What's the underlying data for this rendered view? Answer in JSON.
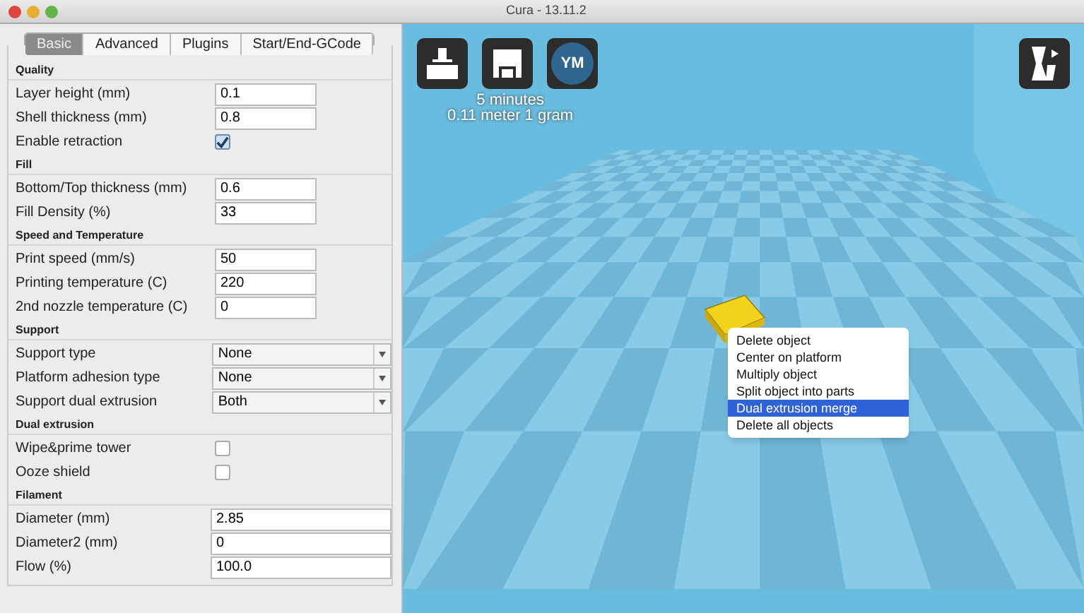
{
  "window": {
    "title": "Cura - 13.11.2"
  },
  "tabs": [
    {
      "label": "Basic",
      "selected": true
    },
    {
      "label": "Advanced",
      "selected": false
    },
    {
      "label": "Plugins",
      "selected": false
    },
    {
      "label": "Start/End-GCode",
      "selected": false
    }
  ],
  "sections": [
    {
      "title": "Quality",
      "items": [
        {
          "kind": "text",
          "label": "Layer height (mm)",
          "value": "0.1"
        },
        {
          "kind": "text",
          "label": "Shell thickness (mm)",
          "value": "0.8"
        },
        {
          "kind": "checkbox",
          "label": "Enable retraction",
          "checked": true
        }
      ]
    },
    {
      "title": "Fill",
      "items": [
        {
          "kind": "text",
          "label": "Bottom/Top thickness (mm)",
          "value": "0.6"
        },
        {
          "kind": "text",
          "label": "Fill Density (%)",
          "value": "33"
        }
      ]
    },
    {
      "title": "Speed and Temperature",
      "items": [
        {
          "kind": "text",
          "label": "Print speed (mm/s)",
          "value": "50"
        },
        {
          "kind": "text",
          "label": "Printing temperature (C)",
          "value": "220"
        },
        {
          "kind": "text",
          "label": "2nd nozzle temperature (C)",
          "value": "0"
        }
      ]
    },
    {
      "title": "Support",
      "items": [
        {
          "kind": "select",
          "label": "Support type",
          "value": "None"
        },
        {
          "kind": "select",
          "label": "Platform adhesion type",
          "value": "None"
        },
        {
          "kind": "select",
          "label": "Support dual extrusion",
          "value": "Both"
        }
      ]
    },
    {
      "title": "Dual extrusion",
      "items": [
        {
          "kind": "checkbox",
          "label": "Wipe&prime tower",
          "checked": false
        },
        {
          "kind": "checkbox",
          "label": "Ooze shield",
          "checked": false
        }
      ]
    },
    {
      "title": "Filament",
      "items": [
        {
          "kind": "wide",
          "label": "Diameter (mm)",
          "value": "2.85"
        },
        {
          "kind": "wide",
          "label": "Diameter2 (mm)",
          "value": "0"
        },
        {
          "kind": "wide",
          "label": "Flow (%)",
          "value": "100.0"
        }
      ]
    }
  ],
  "viewport": {
    "avatar": "YM",
    "print_info": [
      "5 minutes",
      "0.11 meter 1 gram"
    ]
  },
  "context_menu": [
    {
      "label": "Delete object",
      "selected": false
    },
    {
      "label": "Center on platform",
      "selected": false
    },
    {
      "label": "Multiply object",
      "selected": false
    },
    {
      "label": "Split object into parts",
      "selected": false
    },
    {
      "label": "Dual extrusion merge",
      "selected": true
    },
    {
      "label": "Delete all objects",
      "selected": false
    }
  ]
}
